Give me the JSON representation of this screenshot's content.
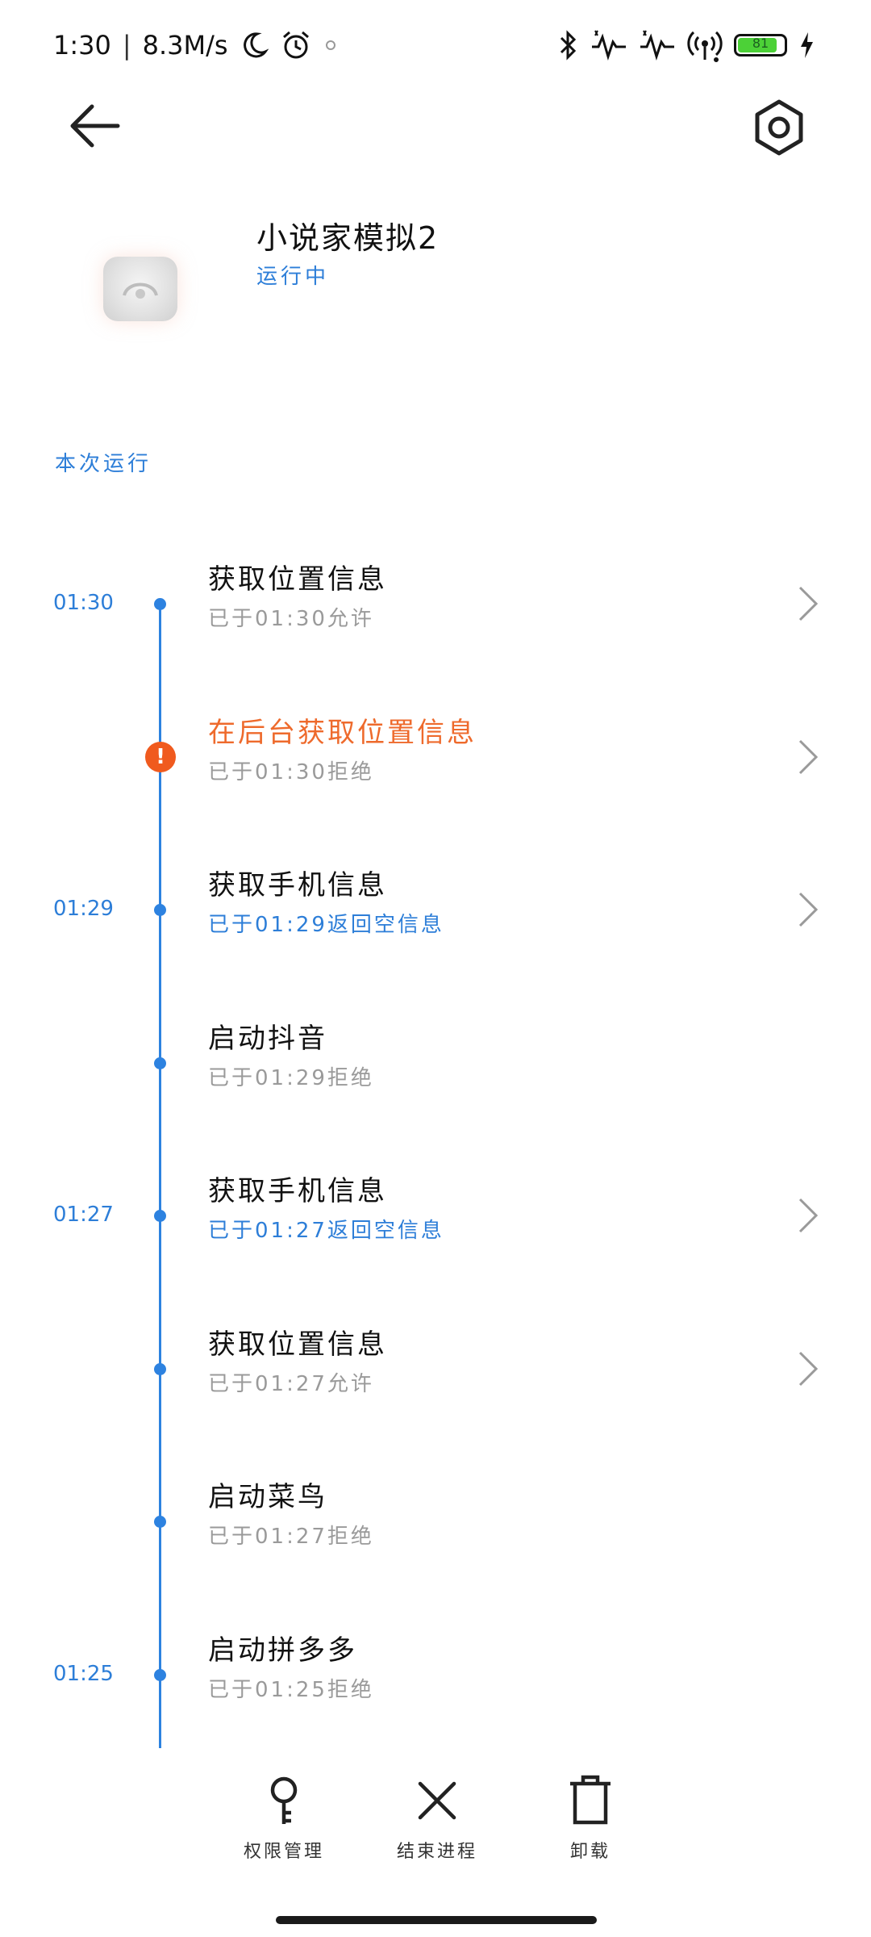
{
  "status_bar": {
    "time": "1:30",
    "net_speed": "8.3M/s",
    "battery": "81",
    "icons": [
      "moon-icon",
      "alarm-icon",
      "bluetooth-icon",
      "signal-icon",
      "hotspot-icon",
      "battery-icon",
      "charging-icon"
    ]
  },
  "header": {
    "back_icon": "back-arrow-icon",
    "settings_icon": "settings-icon"
  },
  "app": {
    "name": "小说家模拟2",
    "status": "运行中"
  },
  "section": {
    "title": "本次运行"
  },
  "timeline": [
    {
      "time": "01:30",
      "title": "获取位置信息",
      "sub": "已于01:30允许",
      "warn": false,
      "sub_blue": false,
      "chevron": true
    },
    {
      "time": "",
      "title": "在后台获取位置信息",
      "sub": "已于01:30拒绝",
      "warn": true,
      "sub_blue": false,
      "chevron": true
    },
    {
      "time": "01:29",
      "title": "获取手机信息",
      "sub": "已于01:29返回空信息",
      "warn": false,
      "sub_blue": true,
      "chevron": true
    },
    {
      "time": "",
      "title": "启动抖音",
      "sub": "已于01:29拒绝",
      "warn": false,
      "sub_blue": false,
      "chevron": false
    },
    {
      "time": "01:27",
      "title": "获取手机信息",
      "sub": "已于01:27返回空信息",
      "warn": false,
      "sub_blue": true,
      "chevron": true
    },
    {
      "time": "",
      "title": "获取位置信息",
      "sub": "已于01:27允许",
      "warn": false,
      "sub_blue": false,
      "chevron": true
    },
    {
      "time": "",
      "title": "启动菜鸟",
      "sub": "已于01:27拒绝",
      "warn": false,
      "sub_blue": false,
      "chevron": false
    },
    {
      "time": "01:25",
      "title": "启动拼多多",
      "sub": "已于01:25拒绝",
      "warn": false,
      "sub_blue": false,
      "chevron": false
    }
  ],
  "actions": [
    {
      "label": "权限管理",
      "icon": "key-icon"
    },
    {
      "label": "结束进程",
      "icon": "close-icon"
    },
    {
      "label": "卸载",
      "icon": "trash-icon"
    }
  ],
  "colors": {
    "accent": "#2d82e0",
    "warning": "#f05a1e"
  }
}
